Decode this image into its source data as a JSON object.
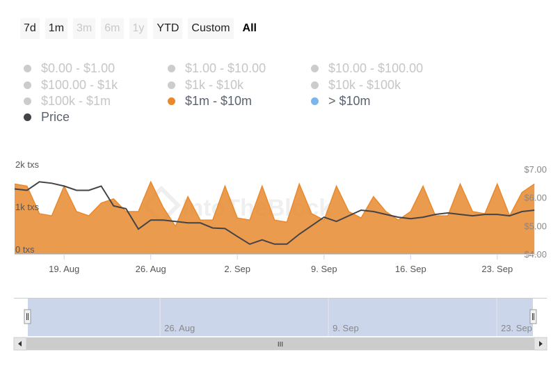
{
  "range_selector": {
    "buttons": [
      {
        "label": "7d",
        "state": "normal"
      },
      {
        "label": "1m",
        "state": "normal"
      },
      {
        "label": "3m",
        "state": "disabled"
      },
      {
        "label": "6m",
        "state": "disabled"
      },
      {
        "label": "1y",
        "state": "disabled"
      },
      {
        "label": "YTD",
        "state": "normal"
      },
      {
        "label": "Custom",
        "state": "normal"
      },
      {
        "label": "All",
        "state": "active"
      }
    ]
  },
  "legend": {
    "items": [
      {
        "label": "$0.00 - $1.00",
        "active": false
      },
      {
        "label": "$1.00 - $10.00",
        "active": false
      },
      {
        "label": "$10.00 - $100.00",
        "active": false
      },
      {
        "label": "$100.00 - $1k",
        "active": false
      },
      {
        "label": "$1k - $10k",
        "active": false
      },
      {
        "label": "$10k - $100k",
        "active": false
      },
      {
        "label": "$100k - $1m",
        "active": false
      },
      {
        "label": "$1m - $10m",
        "active": true,
        "color": "#e8892e"
      },
      {
        "label": "> $10m",
        "active": true,
        "color": "#7cb5ec"
      },
      {
        "label": "Price",
        "active": true,
        "color": "#434348"
      }
    ]
  },
  "watermark": "IntoTheBlock",
  "chart_data": {
    "type": "area",
    "x_labels": [
      "19. Aug",
      "26. Aug",
      "2. Sep",
      "9. Sep",
      "16. Sep",
      "23. Sep"
    ],
    "y_left": {
      "ticks": [
        "0 txs",
        "1k txs",
        "2k txs"
      ],
      "range": [
        0,
        2000
      ]
    },
    "y_right": {
      "ticks": [
        "$4.00",
        "$5.00",
        "$6.00",
        "$7.00"
      ],
      "range": [
        4,
        7
      ]
    },
    "x_range": [
      "2024-08-15",
      "2024-09-27"
    ],
    "series": [
      {
        "name": "$1m - $10m",
        "color": "#e8892e",
        "axis": "left",
        "kind": "area",
        "points": [
          [
            "2024-08-15",
            1650
          ],
          [
            "2024-08-16",
            1600
          ],
          [
            "2024-08-17",
            950
          ],
          [
            "2024-08-18",
            900
          ],
          [
            "2024-08-19",
            1600
          ],
          [
            "2024-08-20",
            1000
          ],
          [
            "2024-08-21",
            900
          ],
          [
            "2024-08-22",
            1200
          ],
          [
            "2024-08-23",
            1300
          ],
          [
            "2024-08-24",
            1000
          ],
          [
            "2024-08-25",
            1000
          ],
          [
            "2024-08-26",
            1700
          ],
          [
            "2024-08-27",
            1100
          ],
          [
            "2024-08-28",
            650
          ],
          [
            "2024-08-29",
            1350
          ],
          [
            "2024-08-30",
            800
          ],
          [
            "2024-08-31",
            800
          ],
          [
            "2024-09-01",
            1600
          ],
          [
            "2024-09-02",
            850
          ],
          [
            "2024-09-03",
            800
          ],
          [
            "2024-09-04",
            1600
          ],
          [
            "2024-09-05",
            800
          ],
          [
            "2024-09-06",
            750
          ],
          [
            "2024-09-07",
            1650
          ],
          [
            "2024-09-08",
            950
          ],
          [
            "2024-09-09",
            800
          ],
          [
            "2024-09-10",
            1600
          ],
          [
            "2024-09-11",
            1000
          ],
          [
            "2024-09-12",
            850
          ],
          [
            "2024-09-13",
            1350
          ],
          [
            "2024-09-14",
            1000
          ],
          [
            "2024-09-15",
            800
          ],
          [
            "2024-09-16",
            1000
          ],
          [
            "2024-09-17",
            1600
          ],
          [
            "2024-09-18",
            900
          ],
          [
            "2024-09-19",
            900
          ],
          [
            "2024-09-20",
            1650
          ],
          [
            "2024-09-21",
            1000
          ],
          [
            "2024-09-22",
            950
          ],
          [
            "2024-09-23",
            1650
          ],
          [
            "2024-09-24",
            900
          ],
          [
            "2024-09-25",
            1450
          ],
          [
            "2024-09-26",
            1650
          ]
        ]
      },
      {
        "name": "> $10m",
        "color": "#7cb5ec",
        "axis": "left",
        "kind": "line",
        "points": [
          [
            "2024-08-15",
            20
          ],
          [
            "2024-09-26",
            20
          ]
        ]
      },
      {
        "name": "Price",
        "color": "#434348",
        "axis": "right",
        "kind": "line",
        "points": [
          [
            "2024-08-15",
            6.3
          ],
          [
            "2024-08-16",
            6.25
          ],
          [
            "2024-08-17",
            6.55
          ],
          [
            "2024-08-18",
            6.5
          ],
          [
            "2024-08-19",
            6.4
          ],
          [
            "2024-08-20",
            6.25
          ],
          [
            "2024-08-21",
            6.25
          ],
          [
            "2024-08-22",
            6.4
          ],
          [
            "2024-08-23",
            5.7
          ],
          [
            "2024-08-24",
            5.6
          ],
          [
            "2024-08-25",
            4.88
          ],
          [
            "2024-08-26",
            5.2
          ],
          [
            "2024-08-27",
            5.2
          ],
          [
            "2024-08-28",
            5.15
          ],
          [
            "2024-08-29",
            5.1
          ],
          [
            "2024-08-30",
            5.1
          ],
          [
            "2024-08-31",
            4.92
          ],
          [
            "2024-09-01",
            4.9
          ],
          [
            "2024-09-02",
            4.62
          ],
          [
            "2024-09-03",
            4.35
          ],
          [
            "2024-09-04",
            4.5
          ],
          [
            "2024-09-05",
            4.35
          ],
          [
            "2024-09-06",
            4.35
          ],
          [
            "2024-09-07",
            4.7
          ],
          [
            "2024-09-08",
            5.0
          ],
          [
            "2024-09-09",
            5.3
          ],
          [
            "2024-09-10",
            5.15
          ],
          [
            "2024-09-11",
            5.35
          ],
          [
            "2024-09-12",
            5.55
          ],
          [
            "2024-09-13",
            5.5
          ],
          [
            "2024-09-14",
            5.4
          ],
          [
            "2024-09-15",
            5.3
          ],
          [
            "2024-09-16",
            5.25
          ],
          [
            "2024-09-17",
            5.3
          ],
          [
            "2024-09-18",
            5.4
          ],
          [
            "2024-09-19",
            5.45
          ],
          [
            "2024-09-20",
            5.4
          ],
          [
            "2024-09-21",
            5.35
          ],
          [
            "2024-09-22",
            5.4
          ],
          [
            "2024-09-23",
            5.4
          ],
          [
            "2024-09-24",
            5.35
          ],
          [
            "2024-09-25",
            5.5
          ],
          [
            "2024-09-26",
            5.55
          ]
        ]
      }
    ],
    "grid": false,
    "legend_position": "top-left"
  },
  "navigator": {
    "labels": [
      "26. Aug",
      "9. Sep",
      "23. Sep"
    ],
    "scrollbar_grip": "III",
    "selected_range": [
      "2024-08-15",
      "2024-09-26"
    ]
  },
  "colors": {
    "nav_fill": "#ccd6eb",
    "scroll_bg": "#f2f2f2",
    "scroll_thumb": "#cccccc"
  }
}
